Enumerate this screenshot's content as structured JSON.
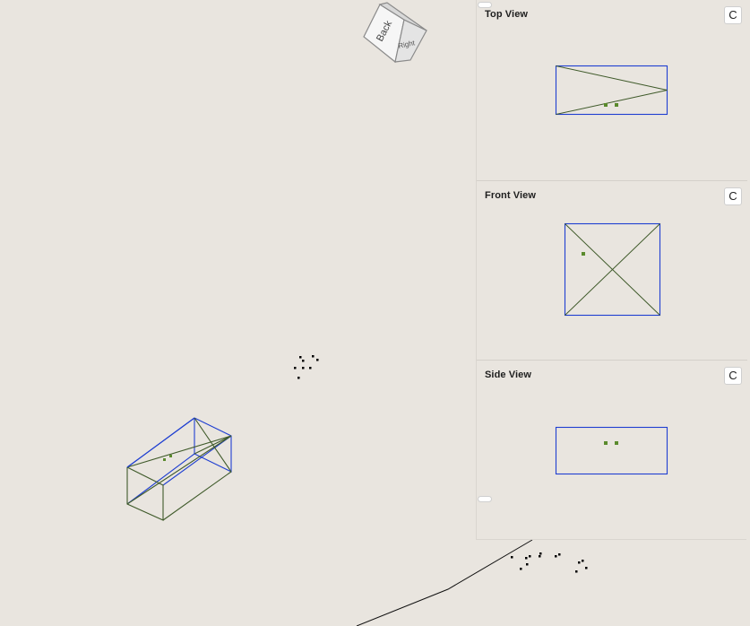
{
  "viewcube": {
    "back_label": "Back",
    "right_label": "Right"
  },
  "views": {
    "top": {
      "title": "Top View",
      "reset_label": "C"
    },
    "front": {
      "title": "Front View",
      "reset_label": "C"
    },
    "side": {
      "title": "Side View",
      "reset_label": "C"
    }
  },
  "colors": {
    "background": "#e9e5df",
    "edge_blue": "#1f3fd1",
    "edge_green": "#3f5a2a",
    "point_green": "#5a8a2c",
    "point_black": "#000000"
  }
}
